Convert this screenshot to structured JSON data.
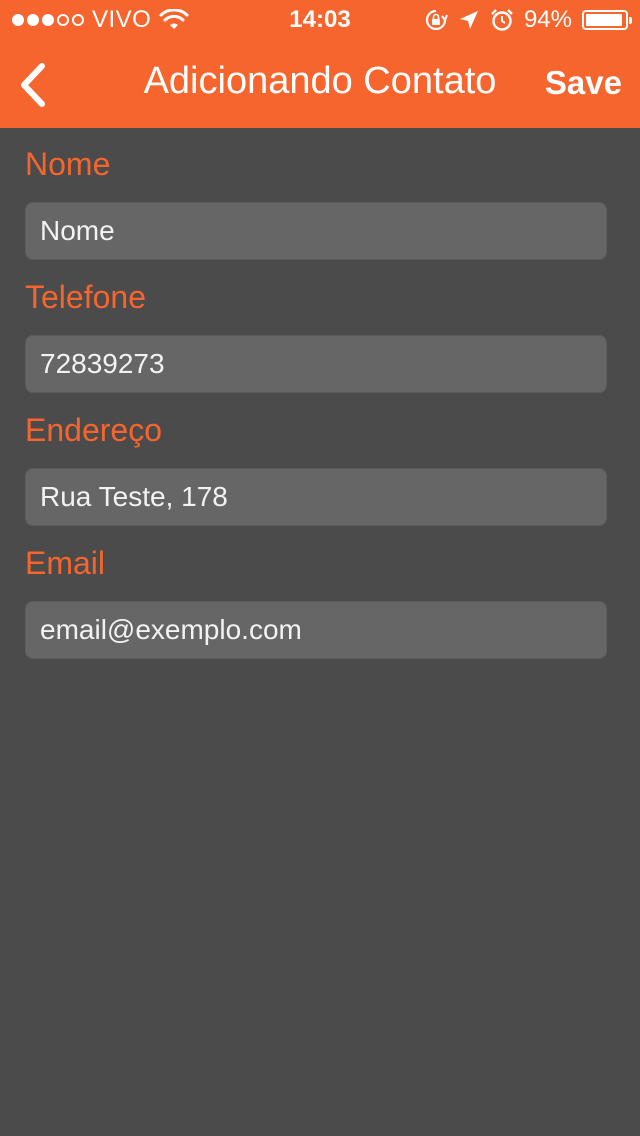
{
  "status_bar": {
    "carrier": "VIVO",
    "time": "14:03",
    "battery": "94%",
    "battery_level": 0.94,
    "signal_bars_filled": 3,
    "signal_bars_total": 5,
    "icons": [
      "wifi-icon",
      "orientation-lock-icon",
      "location-arrow-icon",
      "alarm-icon",
      "battery-icon"
    ]
  },
  "navbar": {
    "title": "Adicionando Contato",
    "back_icon": "chevron-left-icon",
    "save_label": "Save"
  },
  "form": {
    "fields": [
      {
        "label": "Nome",
        "value": "",
        "placeholder": "Nome"
      },
      {
        "label": "Telefone",
        "value": "72839273",
        "placeholder": ""
      },
      {
        "label": "Endereço",
        "value": "Rua Teste, 178",
        "placeholder": ""
      },
      {
        "label": "Email",
        "value": "",
        "placeholder": "email@exemplo.com"
      }
    ]
  },
  "colors": {
    "accent": "#f5652d",
    "background": "#4b4b4b",
    "field_background": "#666666",
    "text_light": "#ffffff"
  }
}
